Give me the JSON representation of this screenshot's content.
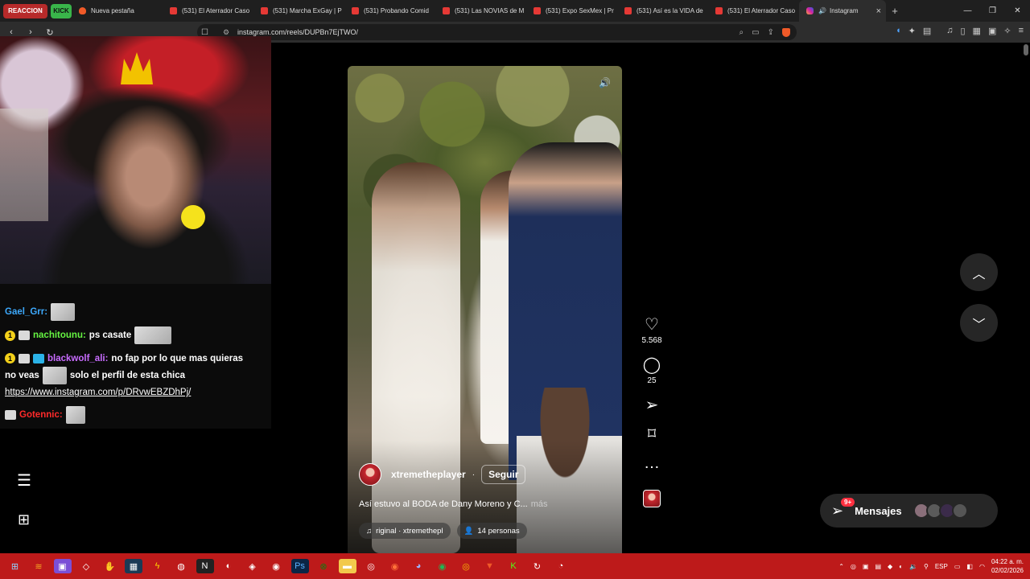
{
  "browser": {
    "tab_groups": [
      {
        "label": "REACCION",
        "color": "#b72a2a"
      },
      {
        "label": "KICK",
        "color": "#39b54a"
      }
    ],
    "tabs": [
      {
        "label": "Nueva pestaña",
        "icon": "brave-icon"
      },
      {
        "label": "(531) El Aterrador Caso",
        "icon": "youtube-icon"
      },
      {
        "label": "(531) Marcha ExGay | P",
        "icon": "youtube-icon"
      },
      {
        "label": "(531) Probando Comid",
        "icon": "youtube-icon"
      },
      {
        "label": "(531) Las NOVIAS de M",
        "icon": "youtube-icon"
      },
      {
        "label": "(531) Expo SexMex | Pr",
        "icon": "youtube-icon"
      },
      {
        "label": "(531) Así es la VIDA de",
        "icon": "youtube-icon"
      },
      {
        "label": "(531) El Aterrador Caso",
        "icon": "youtube-icon"
      }
    ],
    "active_tab": {
      "label": "Instagram",
      "icon": "instagram-icon"
    },
    "url": "instagram.com/reels/DUPBn7EjTWO/"
  },
  "stream": {
    "chat": [
      {
        "user": "Gael_Grr:",
        "message": "",
        "user_color": "#3da9fc"
      },
      {
        "user": "nachitounu:",
        "message": "ps casate",
        "user_color": "#66f542"
      },
      {
        "user": "blackwolf_ali:",
        "message": "no fap por lo que mas quieras",
        "user_color": "#c86cff"
      },
      {
        "user": "",
        "message": "no veas",
        "extra": "solo el perfil de esta chica"
      },
      {
        "user": "",
        "message": "https://www.instagram.com/p/DRvwEBZDhPj/"
      },
      {
        "user": "Gotennic:",
        "message": "",
        "user_color": "#ff2a2a"
      }
    ]
  },
  "reel": {
    "username": "xtremetheplayer",
    "follow_label": "Seguir",
    "caption": "Así estuvo al BODA de Dany Moreno y C...",
    "more_label": "más",
    "audio": "riginal · xtremethepl",
    "people": "14 personas",
    "likes": "5.568",
    "comments": "25"
  },
  "messages": {
    "label": "Mensajes",
    "badge": "9+"
  },
  "taskbar": {
    "lang": "ESP",
    "time": "04:22 a. m.",
    "date": "02/02/2026"
  },
  "colors": {
    "taskbar": "#bd1a1a",
    "page_bg": "#000000",
    "like_badge": "#ff3040"
  }
}
